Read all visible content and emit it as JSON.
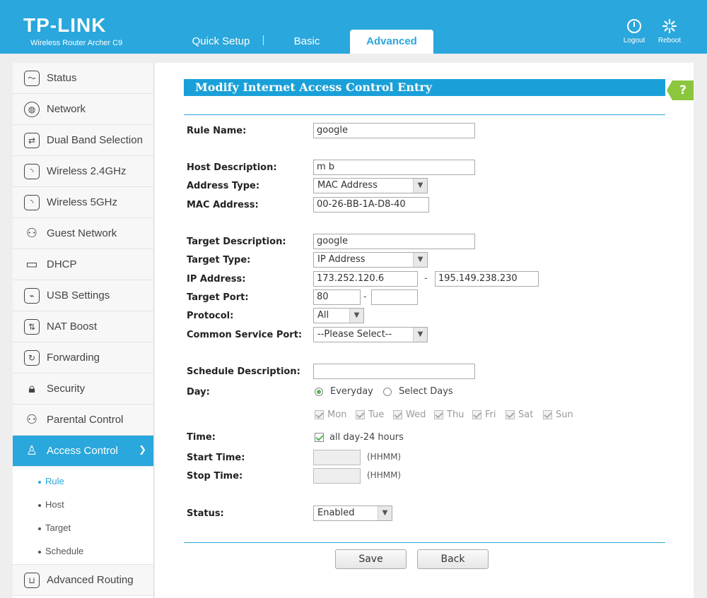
{
  "brand": {
    "logo": "TP-LINK",
    "model": "Wireless Router Archer C9"
  },
  "tabs": [
    "Quick Setup",
    "Basic",
    "Advanced"
  ],
  "header_actions": {
    "logout": "Logout",
    "reboot": "Reboot"
  },
  "sidebar": {
    "items": [
      {
        "label": "Status",
        "icon": "status-icon"
      },
      {
        "label": "Network",
        "icon": "globe-icon"
      },
      {
        "label": "Dual Band Selection",
        "icon": "swap-icon"
      },
      {
        "label": "Wireless 2.4GHz",
        "icon": "wifi-icon"
      },
      {
        "label": "Wireless 5GHz",
        "icon": "wifi-icon"
      },
      {
        "label": "Guest Network",
        "icon": "guests-icon"
      },
      {
        "label": "DHCP",
        "icon": "monitor-icon"
      },
      {
        "label": "USB Settings",
        "icon": "usb-icon"
      },
      {
        "label": "NAT Boost",
        "icon": "nat-boost-icon"
      },
      {
        "label": "Forwarding",
        "icon": "forwarding-icon"
      },
      {
        "label": "Security",
        "icon": "lock-icon"
      },
      {
        "label": "Parental Control",
        "icon": "family-icon"
      },
      {
        "label": "Access Control",
        "icon": "user-lock-icon",
        "active": true
      }
    ],
    "sub_items": [
      "Rule",
      "Host",
      "Target",
      "Schedule"
    ],
    "active_sub": "Rule",
    "last_item": {
      "label": "Advanced Routing",
      "icon": "routing-icon"
    }
  },
  "form": {
    "title": "Modify Internet Access Control Entry",
    "help": "?",
    "rule_name": {
      "label": "Rule Name:",
      "value": "google"
    },
    "host_description": {
      "label": "Host Description:",
      "value": "m b"
    },
    "address_type": {
      "label": "Address Type:",
      "value": "MAC Address"
    },
    "mac_address": {
      "label": "MAC Address:",
      "value": "00-26-BB-1A-D8-40"
    },
    "target_description": {
      "label": "Target Description:",
      "value": "google"
    },
    "target_type": {
      "label": "Target Type:",
      "value": "IP Address"
    },
    "ip_address": {
      "label": "IP Address:",
      "start": "173.252.120.6",
      "end": "195.149.238.230",
      "sep": "-"
    },
    "target_port": {
      "label": "Target Port:",
      "start": "80",
      "end": "",
      "sep": "-"
    },
    "protocol": {
      "label": "Protocol:",
      "value": "All"
    },
    "common_service_port": {
      "label": "Common Service Port:",
      "value": "--Please Select--"
    },
    "schedule_description": {
      "label": "Schedule Description:",
      "value": ""
    },
    "day": {
      "label": "Day:",
      "everyday": "Everyday",
      "select_days": "Select Days",
      "selected": "Everyday"
    },
    "days": [
      "Mon",
      "Tue",
      "Wed",
      "Thu",
      "Fri",
      "Sat",
      "Sun"
    ],
    "time": {
      "label": "Time:",
      "all_day": "all day-24 hours",
      "checked": true
    },
    "start_time": {
      "label": "Start Time:",
      "value": "",
      "hint": "(HHMM)"
    },
    "stop_time": {
      "label": "Stop Time:",
      "value": "",
      "hint": "(HHMM)"
    },
    "status": {
      "label": "Status:",
      "value": "Enabled"
    }
  },
  "buttons": {
    "save": "Save",
    "back": "Back"
  },
  "colors": {
    "primary": "#2aa7dc",
    "title_bar": "#1aa0d8",
    "help": "#8cc63e",
    "radio_on": "#5ab55a"
  }
}
